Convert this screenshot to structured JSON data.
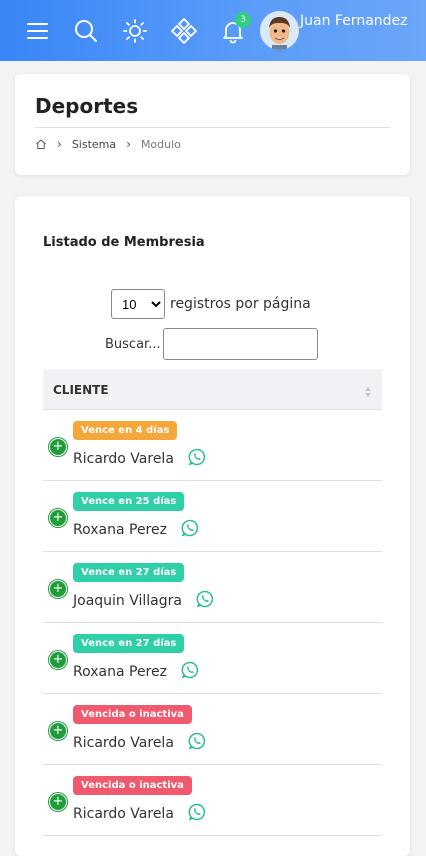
{
  "header": {
    "user_name": "Juan Fernandez",
    "notification_count": "3",
    "icons": [
      "menu-icon",
      "search-icon",
      "sun-icon",
      "apps-icon",
      "bell-icon"
    ]
  },
  "page": {
    "title": "Deportes",
    "breadcrumb": {
      "home_icon": "home-icon",
      "items": [
        "Sistema",
        "Modulo"
      ]
    }
  },
  "list": {
    "title": "Listado de Membresia",
    "page_length": {
      "selected": "10",
      "label": "registros por página"
    },
    "search": {
      "label": "Buscar...",
      "value": ""
    },
    "column_header": "CLIENTE",
    "rows": [
      {
        "badge": "Vence en 4 días",
        "badge_color": "#f5a73a",
        "name": "Ricardo Varela"
      },
      {
        "badge": "Vence en 25 días",
        "badge_color": "#2fd0a7",
        "name": "Roxana Perez"
      },
      {
        "badge": "Vence en 27 días",
        "badge_color": "#2fd0a7",
        "name": "Joaquin Villagra"
      },
      {
        "badge": "Vence en 27 días",
        "badge_color": "#2fd0a7",
        "name": "Roxana Perez"
      },
      {
        "badge": "Vencida o inactiva",
        "badge_color": "#ef5a6f",
        "name": "Ricardo Varela"
      },
      {
        "badge": "Vencida o inactiva",
        "badge_color": "#ef5a6f",
        "name": "Ricardo Varela"
      }
    ]
  },
  "colors": {
    "topbar": "#3a86f7",
    "whatsapp": "#2dbf8e",
    "expand_button": "#1e9d3a"
  }
}
